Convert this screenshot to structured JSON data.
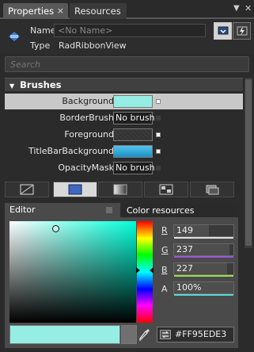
{
  "tabs": [
    {
      "label": "Properties",
      "close": "×",
      "active": true
    },
    {
      "label": "Resources",
      "active": false
    }
  ],
  "window_controls": {
    "pin": "▼",
    "close": "✕"
  },
  "header": {
    "name_label": "Name",
    "name_placeholder": "<No Name>",
    "type_label": "Type",
    "type_value": "RadRibbonView"
  },
  "search": {
    "placeholder": "Search"
  },
  "brushes": {
    "section_title": "Brushes",
    "rows": [
      {
        "label": "Background",
        "value": "",
        "swatch": "#95ede3",
        "selected": true
      },
      {
        "label": "BorderBrush",
        "value": "No brush"
      },
      {
        "label": "Foreground",
        "value": ""
      },
      {
        "label": "TitleBarBackground",
        "value": "",
        "swatch": "#2aa8d8"
      },
      {
        "label": "OpacityMask",
        "value": "No brush"
      }
    ]
  },
  "editor": {
    "tab_editor": "Editor",
    "tab_resources": "Color resources",
    "channels": [
      {
        "label": "R",
        "value": "149",
        "fraction": 0.584,
        "color": "#e0e0e0"
      },
      {
        "label": "G",
        "value": "237",
        "fraction": 0.929,
        "color": "#9a58d8"
      },
      {
        "label": "B",
        "value": "227",
        "fraction": 0.89,
        "color": "#9be04a"
      },
      {
        "label": "A",
        "value": "100%",
        "fraction": 1.0,
        "color": "#5ad8d8"
      }
    ],
    "hex": "#FF95EDE3",
    "current_color": "#95ede3"
  }
}
